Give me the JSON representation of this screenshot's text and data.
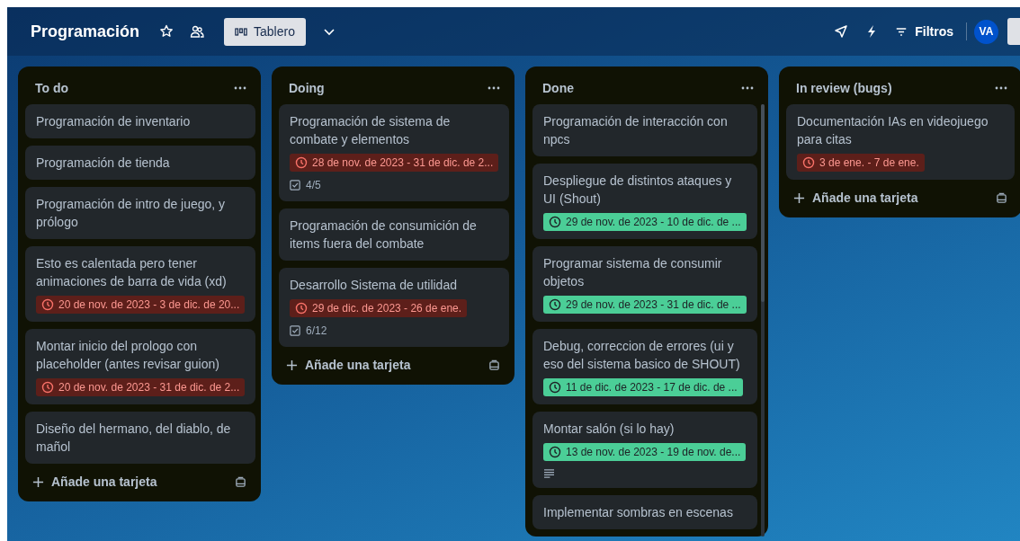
{
  "board": {
    "title": "Programación",
    "view_button": "Tablero",
    "filter_button": "Filtros",
    "avatar": "VA"
  },
  "lists": [
    {
      "title": "To do",
      "add_card": "Añade una tarjeta",
      "cards": [
        {
          "title": "Programación de inventario"
        },
        {
          "title": "Programación de tienda"
        },
        {
          "title": "Programación de intro de juego, y prólogo"
        },
        {
          "title": "Esto es calentada pero tener animaciones de barra de vida (xd)",
          "dates": {
            "text": "20 de nov. de 2023 - 3 de dic. de 20...",
            "complete": false
          }
        },
        {
          "title": "Montar inicio del prologo con placeholder (antes revisar guion)",
          "dates": {
            "text": "20 de nov. de 2023 - 31 de dic. de 2...",
            "complete": false
          }
        },
        {
          "title": "Diseño del hermano, del diablo, de mañol"
        }
      ]
    },
    {
      "title": "Doing",
      "add_card": "Añade una tarjeta",
      "cards": [
        {
          "title": "Programación de sistema de combate y elementos",
          "dates": {
            "text": "28 de nov. de 2023 - 31 de dic. de 2...",
            "complete": false
          },
          "checklist": "4/5"
        },
        {
          "title": "Programación de consumición de items fuera del combate"
        },
        {
          "title": "Desarrollo Sistema de utilidad",
          "dates": {
            "text": "29 de dic. de 2023 - 26 de ene.",
            "complete": false
          },
          "checklist": "6/12"
        }
      ]
    },
    {
      "title": "Done",
      "scrollable": true,
      "cards": [
        {
          "title": "Programación de interacción con npcs"
        },
        {
          "title": "Despliegue de distintos ataques y UI (Shout)",
          "dates": {
            "text": "29 de nov. de 2023 - 10 de dic. de ...",
            "complete": true
          }
        },
        {
          "title": "Programar sistema de consumir objetos",
          "dates": {
            "text": "29 de nov. de 2023 - 31 de dic. de ...",
            "complete": true
          }
        },
        {
          "title": "Debug, correccion de errores (ui y eso del sistema basico de SHOUT)",
          "dates": {
            "text": "11 de dic. de 2023 - 17 de dic. de ...",
            "complete": true
          }
        },
        {
          "title": "Montar salón (si lo hay)",
          "dates": {
            "text": "13 de nov. de 2023 - 19 de nov. de...",
            "complete": true
          },
          "description": true
        },
        {
          "title": "Implementar sombras en escenas"
        }
      ]
    },
    {
      "title": "In review (bugs)",
      "add_card": "Añade una tarjeta",
      "cards": [
        {
          "title": "Documentación IAs en videojuego para citas",
          "dates": {
            "text": "3 de ene. - 7 de ene.",
            "complete": false
          }
        }
      ]
    }
  ]
}
